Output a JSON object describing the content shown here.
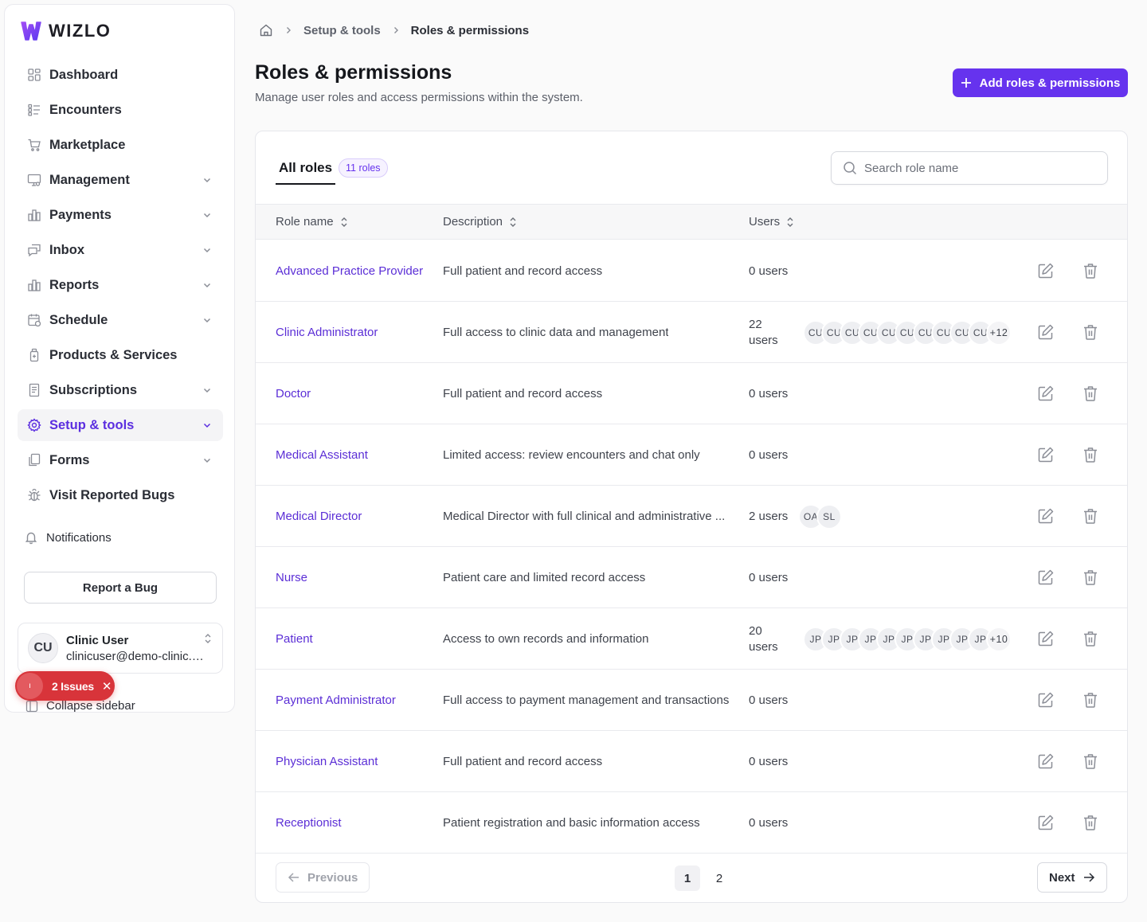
{
  "app": {
    "name": "WIZLO",
    "brand_color": "#6633ee"
  },
  "sidebar": {
    "items": [
      {
        "label": "Dashboard",
        "icon": "dashboard-icon",
        "chevron": false
      },
      {
        "label": "Encounters",
        "icon": "list-icon",
        "chevron": false
      },
      {
        "label": "Marketplace",
        "icon": "cart-icon",
        "chevron": false
      },
      {
        "label": "Management",
        "icon": "monitor-settings-icon",
        "chevron": true
      },
      {
        "label": "Payments",
        "icon": "bar-chart-icon",
        "chevron": true
      },
      {
        "label": "Inbox",
        "icon": "chat-icon",
        "chevron": true
      },
      {
        "label": "Reports",
        "icon": "bar-chart-icon",
        "chevron": true
      },
      {
        "label": "Schedule",
        "icon": "calendar-icon",
        "chevron": true
      },
      {
        "label": "Products & Services",
        "icon": "bottle-icon",
        "chevron": false
      },
      {
        "label": "Subscriptions",
        "icon": "receipt-icon",
        "chevron": true
      },
      {
        "label": "Setup & tools",
        "icon": "gear-icon",
        "chevron": true,
        "active": true
      },
      {
        "label": "Forms",
        "icon": "copy-icon",
        "chevron": true
      },
      {
        "label": "Visit Reported Bugs",
        "icon": "bug-icon",
        "chevron": false
      }
    ],
    "notifications_label": "Notifications",
    "report_bug_label": "Report a Bug",
    "user": {
      "initials": "CU",
      "name": "Clinic User",
      "email": "clinicuser@demo-clinic.com"
    },
    "collapse_label": "Collapse sidebar",
    "issues": {
      "label": "2 Issues",
      "color": "#d8343a"
    }
  },
  "breadcrumb": {
    "items": [
      "Setup & tools",
      "Roles & permissions"
    ]
  },
  "header": {
    "title": "Roles & permissions",
    "subtitle": "Manage user roles and access permissions within the system.",
    "add_button_label": "Add roles & permissions"
  },
  "tabs": {
    "label": "All roles",
    "badge": "11 roles"
  },
  "search": {
    "placeholder": "Search role name"
  },
  "table": {
    "columns": [
      "Role name",
      "Description",
      "Users"
    ],
    "rows": [
      {
        "name": "Advanced Practice Provider",
        "description": "Full patient and record access",
        "users": "0 users",
        "avatars": []
      },
      {
        "name": "Clinic Administrator",
        "description": "Full access to clinic data and management",
        "users": "22 users",
        "avatars": [
          "CU",
          "CU",
          "CU",
          "CU",
          "CU",
          "CU",
          "CU",
          "CU",
          "CU",
          "CU"
        ],
        "more": "+12"
      },
      {
        "name": "Doctor",
        "description": "Full patient and record access",
        "users": "0 users",
        "avatars": []
      },
      {
        "name": "Medical Assistant",
        "description": "Limited access: review encounters and chat only",
        "users": "0 users",
        "avatars": []
      },
      {
        "name": "Medical Director",
        "description": "Medical Director with full clinical and administrative ...",
        "users": "2 users",
        "avatars": [
          "OA",
          "SL"
        ]
      },
      {
        "name": "Nurse",
        "description": "Patient care and limited record access",
        "users": "0 users",
        "avatars": []
      },
      {
        "name": "Patient",
        "description": "Access to own records and information",
        "users": "20 users",
        "avatars": [
          "JP",
          "JP",
          "JP",
          "JP",
          "JP",
          "JP",
          "JP",
          "JP",
          "JP",
          "JP"
        ],
        "more": "+10"
      },
      {
        "name": "Payment Administrator",
        "description": "Full access to payment management and transactions",
        "users": "0 users",
        "avatars": []
      },
      {
        "name": "Physician Assistant",
        "description": "Full patient and record access",
        "users": "0 users",
        "avatars": []
      },
      {
        "name": "Receptionist",
        "description": "Patient registration and basic information access",
        "users": "0 users",
        "avatars": []
      }
    ]
  },
  "pagination": {
    "previous_label": "Previous",
    "next_label": "Next",
    "pages": [
      "1",
      "2"
    ],
    "current": "1"
  }
}
